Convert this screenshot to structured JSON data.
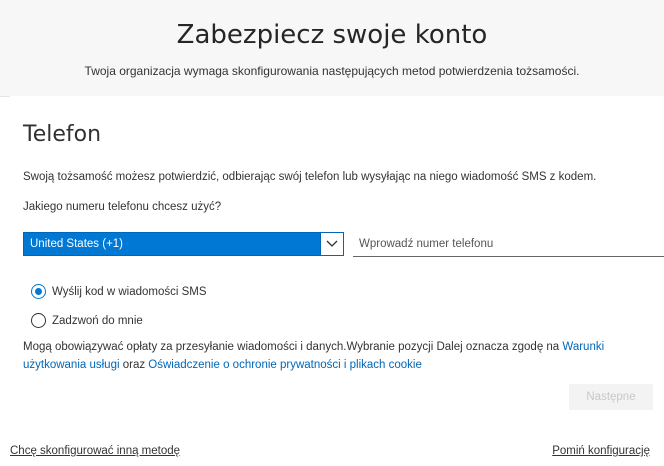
{
  "header": {
    "title": "Zabezpiecz swoje konto",
    "subtitle": "Twoja organizacja wymaga skonfigurowania następujących metod potwierdzenia tożsamości."
  },
  "section": {
    "title": "Telefon",
    "description": "Swoją tożsamość możesz potwierdzić, odbierając swój telefon lub wysyłając na niego wiadomość SMS z kodem.",
    "question": "Jakiego numeru telefonu chcesz użyć?"
  },
  "country_select": {
    "value": "United States (+1)",
    "icon": "chevron-down-icon"
  },
  "phone_input": {
    "placeholder": "Wprowadź numer telefonu",
    "value": ""
  },
  "methods": {
    "sms_label": "Wyślij kod w wiadomości SMS",
    "sms_checked": true,
    "call_label": "Zadzwoń do mnie",
    "call_checked": false
  },
  "terms": {
    "text_before": "Mogą obowiązywać opłaty za przesyłanie wiadomości i danych.Wybranie pozycji Dalej oznacza zgodę na ",
    "link_terms": "Warunki użytkowania usługi",
    "text_mid": " oraz ",
    "link_privacy": "Oświadczenie o ochronie prywatności i plikach cookie"
  },
  "buttons": {
    "next_label": "Następne"
  },
  "footer": {
    "left_link": "Chcę skonfigurować inną metodę",
    "right_link": "Pomiń konfigurację"
  },
  "colors": {
    "accent": "#0078d4",
    "link": "#0067b8",
    "header_bg": "#f7f7f7"
  }
}
